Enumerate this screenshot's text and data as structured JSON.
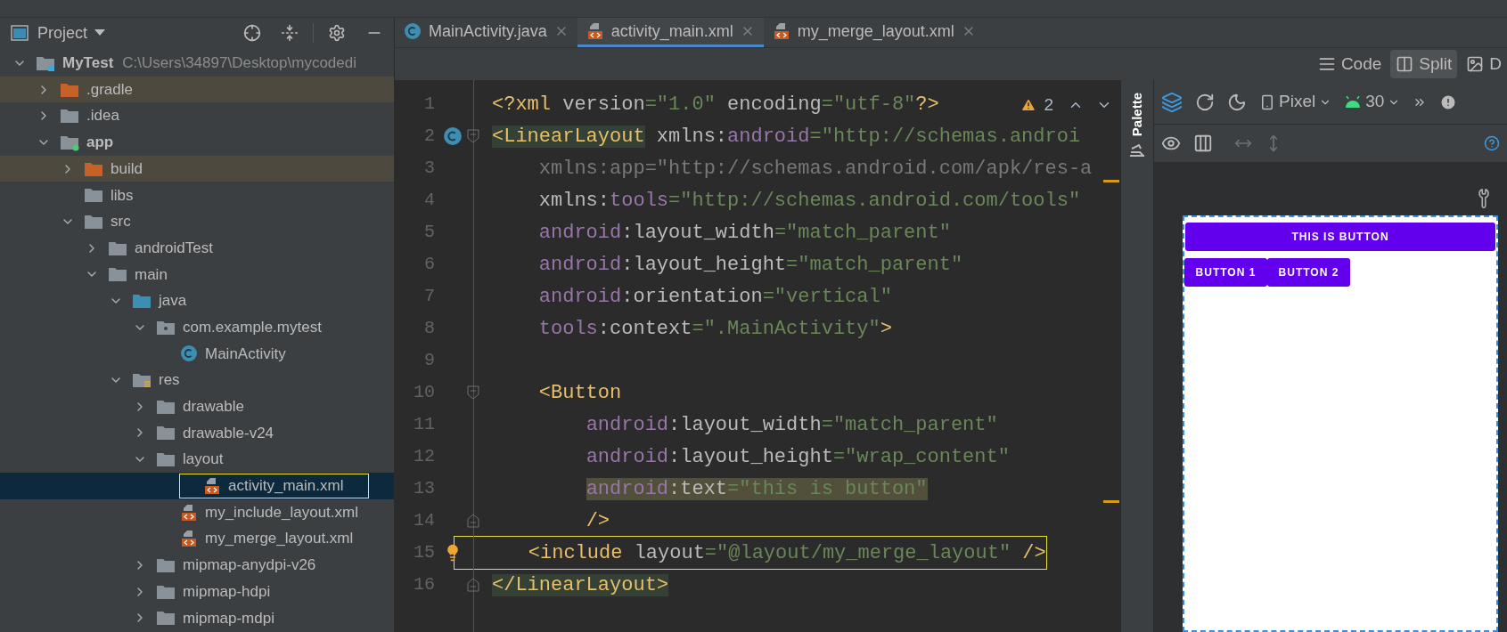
{
  "project_panel": {
    "title": "Project"
  },
  "tree": [
    {
      "label": "MyTest",
      "path": "C:\\Users\\34897\\Desktop\\mycodedi",
      "kind": "project",
      "expanded": true,
      "selected": false,
      "children": [
        {
          "label": ".gradle",
          "kind": "excluded",
          "expanded": false,
          "selected": false
        },
        {
          "label": ".idea",
          "kind": "folder",
          "expanded": false,
          "selected": false
        },
        {
          "label": "app",
          "kind": "module",
          "expanded": true,
          "selected": false,
          "children": [
            {
              "label": "build",
              "kind": "excluded",
              "expanded": false,
              "selected": false
            },
            {
              "label": "libs",
              "kind": "folder",
              "selected": false
            },
            {
              "label": "src",
              "kind": "folder",
              "expanded": true,
              "selected": false,
              "children": [
                {
                  "label": "androidTest",
                  "kind": "folder",
                  "expanded": false,
                  "selected": false
                },
                {
                  "label": "main",
                  "kind": "folder",
                  "expanded": true,
                  "selected": false,
                  "children": [
                    {
                      "label": "java",
                      "kind": "source",
                      "expanded": true,
                      "selected": false,
                      "children": [
                        {
                          "label": "com.example.mytest",
                          "kind": "package",
                          "expanded": true,
                          "selected": false,
                          "children": [
                            {
                              "label": "MainActivity",
                              "kind": "class",
                              "selected": false
                            }
                          ]
                        }
                      ]
                    },
                    {
                      "label": "res",
                      "kind": "resources",
                      "expanded": true,
                      "selected": false,
                      "children": [
                        {
                          "label": "drawable",
                          "kind": "folder",
                          "expanded": false,
                          "selected": false
                        },
                        {
                          "label": "drawable-v24",
                          "kind": "folder",
                          "expanded": false,
                          "selected": false
                        },
                        {
                          "label": "layout",
                          "kind": "folder",
                          "expanded": true,
                          "selected": false,
                          "children": [
                            {
                              "label": "activity_main.xml",
                              "kind": "layout",
                              "selected": true,
                              "outlined": true
                            },
                            {
                              "label": "my_include_layout.xml",
                              "kind": "layout",
                              "selected": false
                            },
                            {
                              "label": "my_merge_layout.xml",
                              "kind": "layout",
                              "selected": false
                            }
                          ]
                        },
                        {
                          "label": "mipmap-anydpi-v26",
                          "kind": "folder",
                          "expanded": false,
                          "selected": false
                        },
                        {
                          "label": "mipmap-hdpi",
                          "kind": "folder",
                          "expanded": false,
                          "selected": false
                        },
                        {
                          "label": "mipmap-mdpi",
                          "kind": "folder",
                          "expanded": false,
                          "selected": false
                        }
                      ]
                    }
                  ]
                }
              ]
            }
          ]
        }
      ]
    }
  ],
  "tabs": [
    {
      "label": "MainActivity.java",
      "kind": "class",
      "selected": false
    },
    {
      "label": "activity_main.xml",
      "kind": "layout",
      "selected": true
    },
    {
      "label": "my_merge_layout.xml",
      "kind": "layout",
      "selected": false
    }
  ],
  "view_modes": [
    {
      "label": "Code",
      "kind": "code",
      "selected": false
    },
    {
      "label": "Split",
      "kind": "split",
      "selected": true
    },
    {
      "label": "D",
      "kind": "design",
      "selected": false
    }
  ],
  "warnings": {
    "count": "2"
  },
  "code": [
    {
      "number": "1",
      "tokens": [
        {
          "kind": "tag",
          "text": "<?xml"
        },
        {
          "kind": "attr",
          "text": " version"
        },
        {
          "kind": "value",
          "text": "=\"1.0\""
        },
        {
          "kind": "attr",
          "text": " encoding"
        },
        {
          "kind": "value",
          "text": "=\"utf-8\""
        },
        {
          "kind": "tag",
          "text": "?>"
        }
      ]
    },
    {
      "number": "2",
      "class_marker": true,
      "fold_start": true,
      "tokens": [
        {
          "kind": "tag",
          "text": "<LinearLayout",
          "highlight": true
        },
        {
          "kind": "attr",
          "text": " xmlns:"
        },
        {
          "kind": "ns",
          "text": "android"
        },
        {
          "kind": "value",
          "text": "=\"http://schemas.androi"
        }
      ]
    },
    {
      "number": "3",
      "stripe": true,
      "tokens": [
        {
          "kind": "unused",
          "text": "    xmlns:app=\"http://schemas.android.com/apk/res-a"
        }
      ]
    },
    {
      "number": "4",
      "tokens": [
        {
          "kind": "attr",
          "text": "    xmlns:"
        },
        {
          "kind": "ns",
          "text": "tools"
        },
        {
          "kind": "value",
          "text": "=\"http://schemas.android.com/tools\""
        }
      ]
    },
    {
      "number": "5",
      "tokens": [
        {
          "kind": "ns",
          "text": "    android"
        },
        {
          "kind": "attr",
          "text": ":layout_width"
        },
        {
          "kind": "value",
          "text": "=\"match_parent\""
        }
      ]
    },
    {
      "number": "6",
      "tokens": [
        {
          "kind": "ns",
          "text": "    android"
        },
        {
          "kind": "attr",
          "text": ":layout_height"
        },
        {
          "kind": "value",
          "text": "=\"match_parent\""
        }
      ]
    },
    {
      "number": "7",
      "tokens": [
        {
          "kind": "ns",
          "text": "    android"
        },
        {
          "kind": "attr",
          "text": ":orientation"
        },
        {
          "kind": "value",
          "text": "=\"vertical\""
        }
      ]
    },
    {
      "number": "8",
      "tokens": [
        {
          "kind": "ns",
          "text": "    tools"
        },
        {
          "kind": "attr",
          "text": ":context"
        },
        {
          "kind": "value",
          "text": "=\".MainActivity\""
        },
        {
          "kind": "tag",
          "text": ">"
        }
      ]
    },
    {
      "number": "9"
    },
    {
      "number": "10",
      "fold_start": true,
      "tokens": [
        {
          "kind": "tag",
          "text": "    <Button"
        }
      ]
    },
    {
      "number": "11",
      "tokens": [
        {
          "kind": "ns",
          "text": "        android"
        },
        {
          "kind": "attr",
          "text": ":layout_width"
        },
        {
          "kind": "value",
          "text": "=\"match_parent\""
        }
      ]
    },
    {
      "number": "12",
      "tokens": [
        {
          "kind": "ns",
          "text": "        android"
        },
        {
          "kind": "attr",
          "text": ":layout_height"
        },
        {
          "kind": "value",
          "text": "=\"wrap_content\""
        }
      ]
    },
    {
      "number": "13",
      "stripe": true,
      "tokens": [
        {
          "kind": "ns",
          "text": "        android",
          "highlight": true
        },
        {
          "kind": "attr",
          "text": ":text",
          "highlight": true
        },
        {
          "kind": "value",
          "text": "=\"this is button\"",
          "highlight": true
        }
      ]
    },
    {
      "number": "14",
      "fold_end": true,
      "tokens": [
        {
          "kind": "tag",
          "text": "        />"
        }
      ]
    },
    {
      "number": "15",
      "intention_bulb": true,
      "outlined": true,
      "tokens": [
        {
          "kind": "tag",
          "text": "    <include"
        },
        {
          "kind": "attr",
          "text": " layout"
        },
        {
          "kind": "value",
          "text": "=\"@layout/my_merge_layout\""
        },
        {
          "kind": "tag",
          "text": " />"
        }
      ]
    },
    {
      "number": "16",
      "fold_end": true,
      "tokens": [
        {
          "kind": "tag",
          "text": "</LinearLayout>",
          "highlight": true
        }
      ]
    }
  ],
  "palette": {
    "label": "Palette"
  },
  "design_toolbar": {
    "device": "Pixel",
    "api": "30"
  },
  "preview": {
    "buttons": [
      {
        "label": "THIS IS BUTTON",
        "kind": "full"
      },
      {
        "label": "BUTTON 1",
        "kind": "inline"
      },
      {
        "label": "BUTTON 2",
        "kind": "inline"
      }
    ]
  }
}
